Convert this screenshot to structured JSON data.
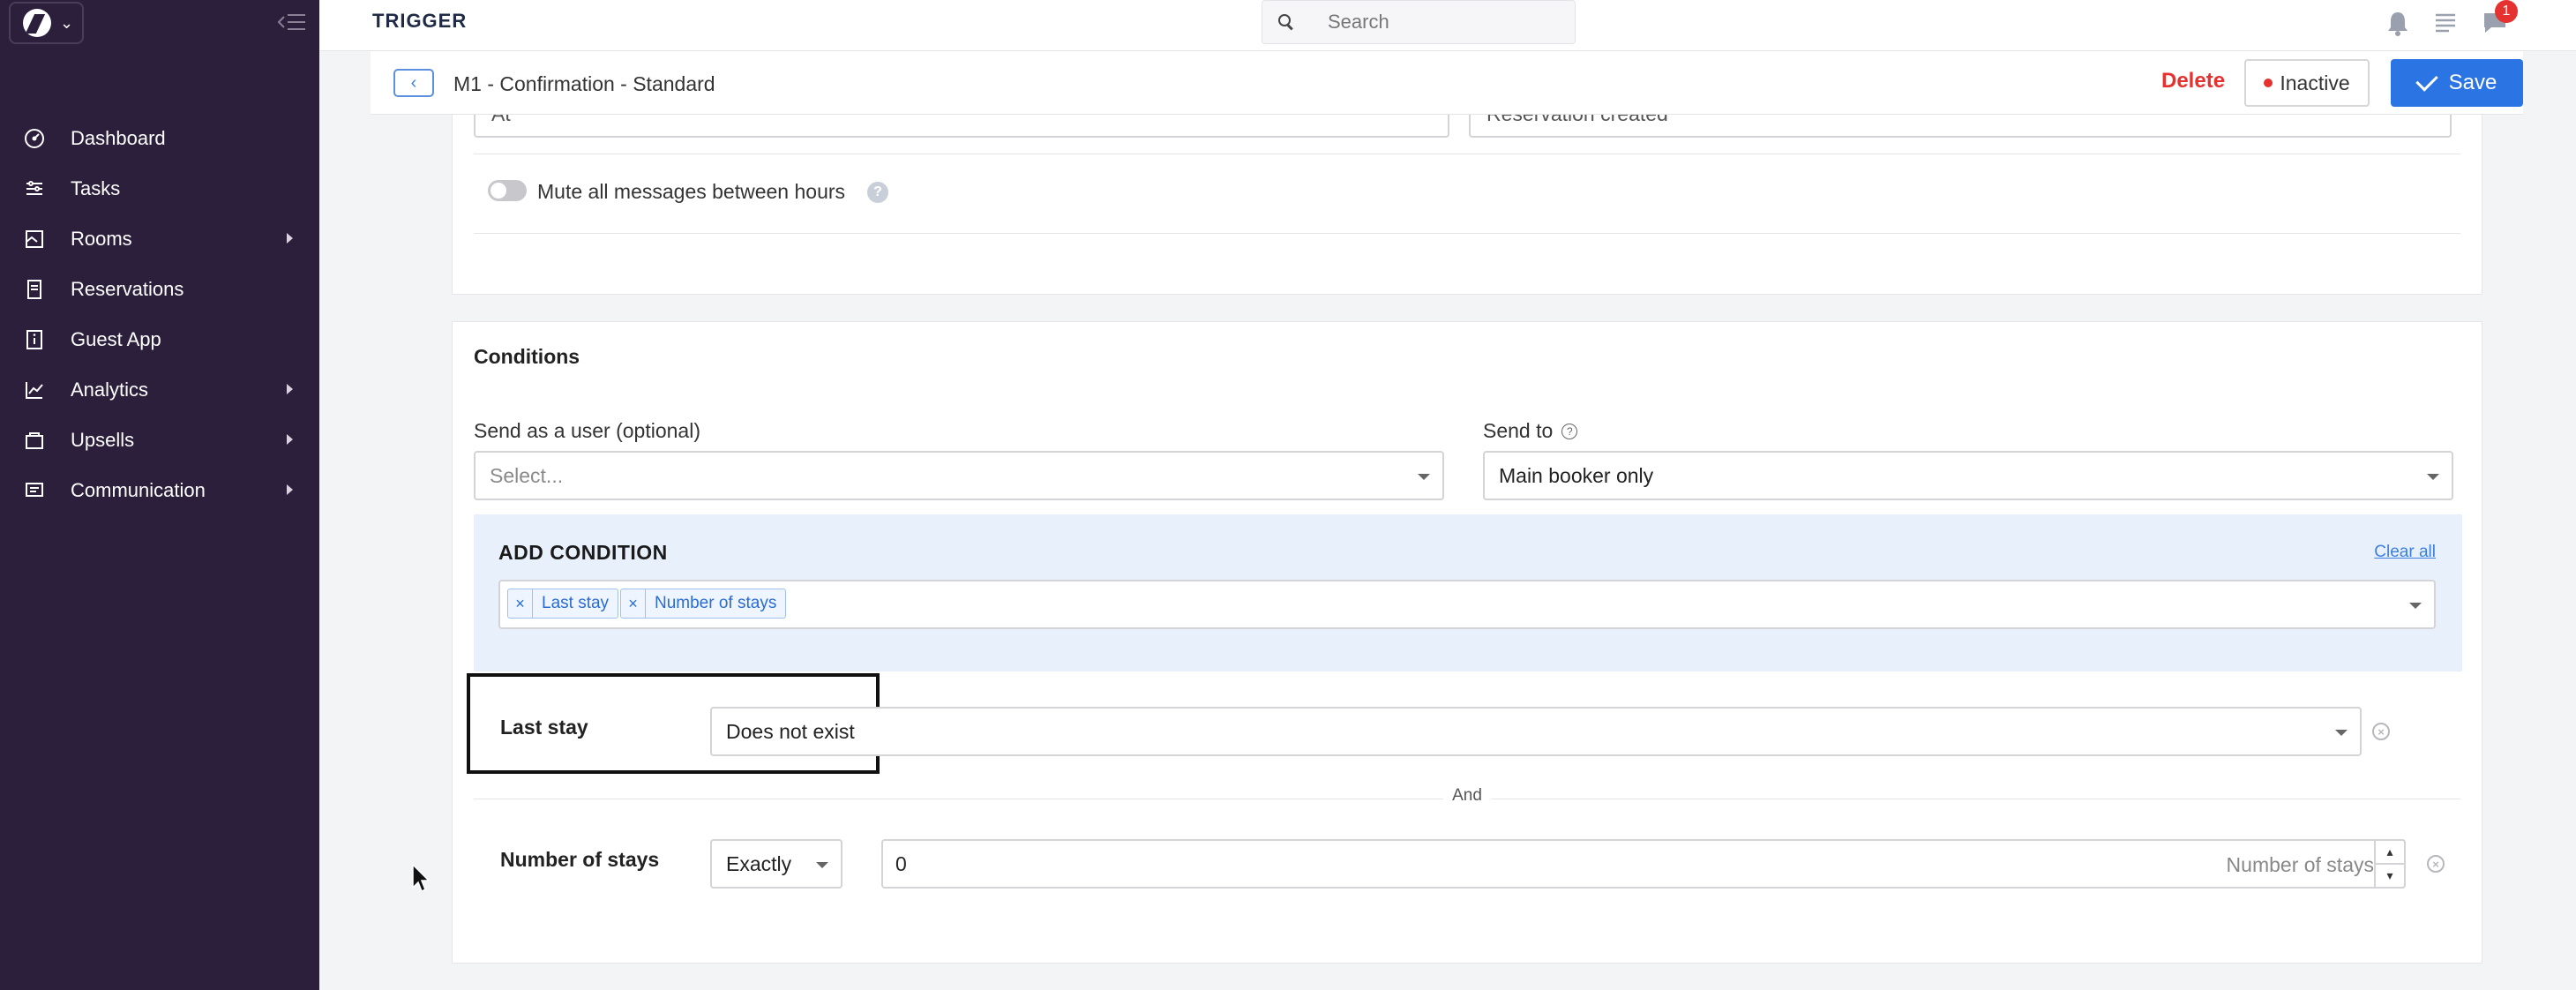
{
  "sidebar": {
    "items": [
      {
        "label": "Dashboard",
        "icon": "dashboard-icon",
        "expandable": false
      },
      {
        "label": "Tasks",
        "icon": "tasks-icon",
        "expandable": false
      },
      {
        "label": "Rooms",
        "icon": "rooms-icon",
        "expandable": true
      },
      {
        "label": "Reservations",
        "icon": "reservations-icon",
        "expandable": false
      },
      {
        "label": "Guest App",
        "icon": "guest-app-icon",
        "expandable": false
      },
      {
        "label": "Analytics",
        "icon": "analytics-icon",
        "expandable": true
      },
      {
        "label": "Upsells",
        "icon": "upsells-icon",
        "expandable": true
      },
      {
        "label": "Communication",
        "icon": "communication-icon",
        "expandable": true
      }
    ]
  },
  "topbar": {
    "title": "TRIGGER",
    "search_placeholder": "Search",
    "notification_count": "1"
  },
  "header": {
    "title": "M1 - Confirmation - Standard",
    "delete_label": "Delete",
    "status_label": "Inactive",
    "save_label": "Save"
  },
  "timing": {
    "left_value": "At",
    "right_value": "Reservation created",
    "mute_label": "Mute all messages between hours",
    "mute_enabled": false
  },
  "conditions": {
    "title": "Conditions",
    "send_as_label": "Send as a user (optional)",
    "send_as_placeholder": "Select...",
    "send_to_label": "Send to",
    "send_to_value": "Main booker only",
    "add_condition_title": "ADD CONDITION",
    "clear_all_label": "Clear all",
    "tags": [
      "Last stay",
      "Number of stays"
    ],
    "last_stay": {
      "label": "Last stay",
      "value": "Does not exist"
    },
    "and_label": "And",
    "number_of_stays": {
      "label": "Number of stays",
      "operator": "Exactly",
      "value": "0",
      "suffix": "Number of stays"
    }
  },
  "colors": {
    "sidebar_bg": "#2c1f3b",
    "primary": "#2b74e4",
    "danger": "#e5312f",
    "add_condition_bg": "#e8f0fc"
  }
}
